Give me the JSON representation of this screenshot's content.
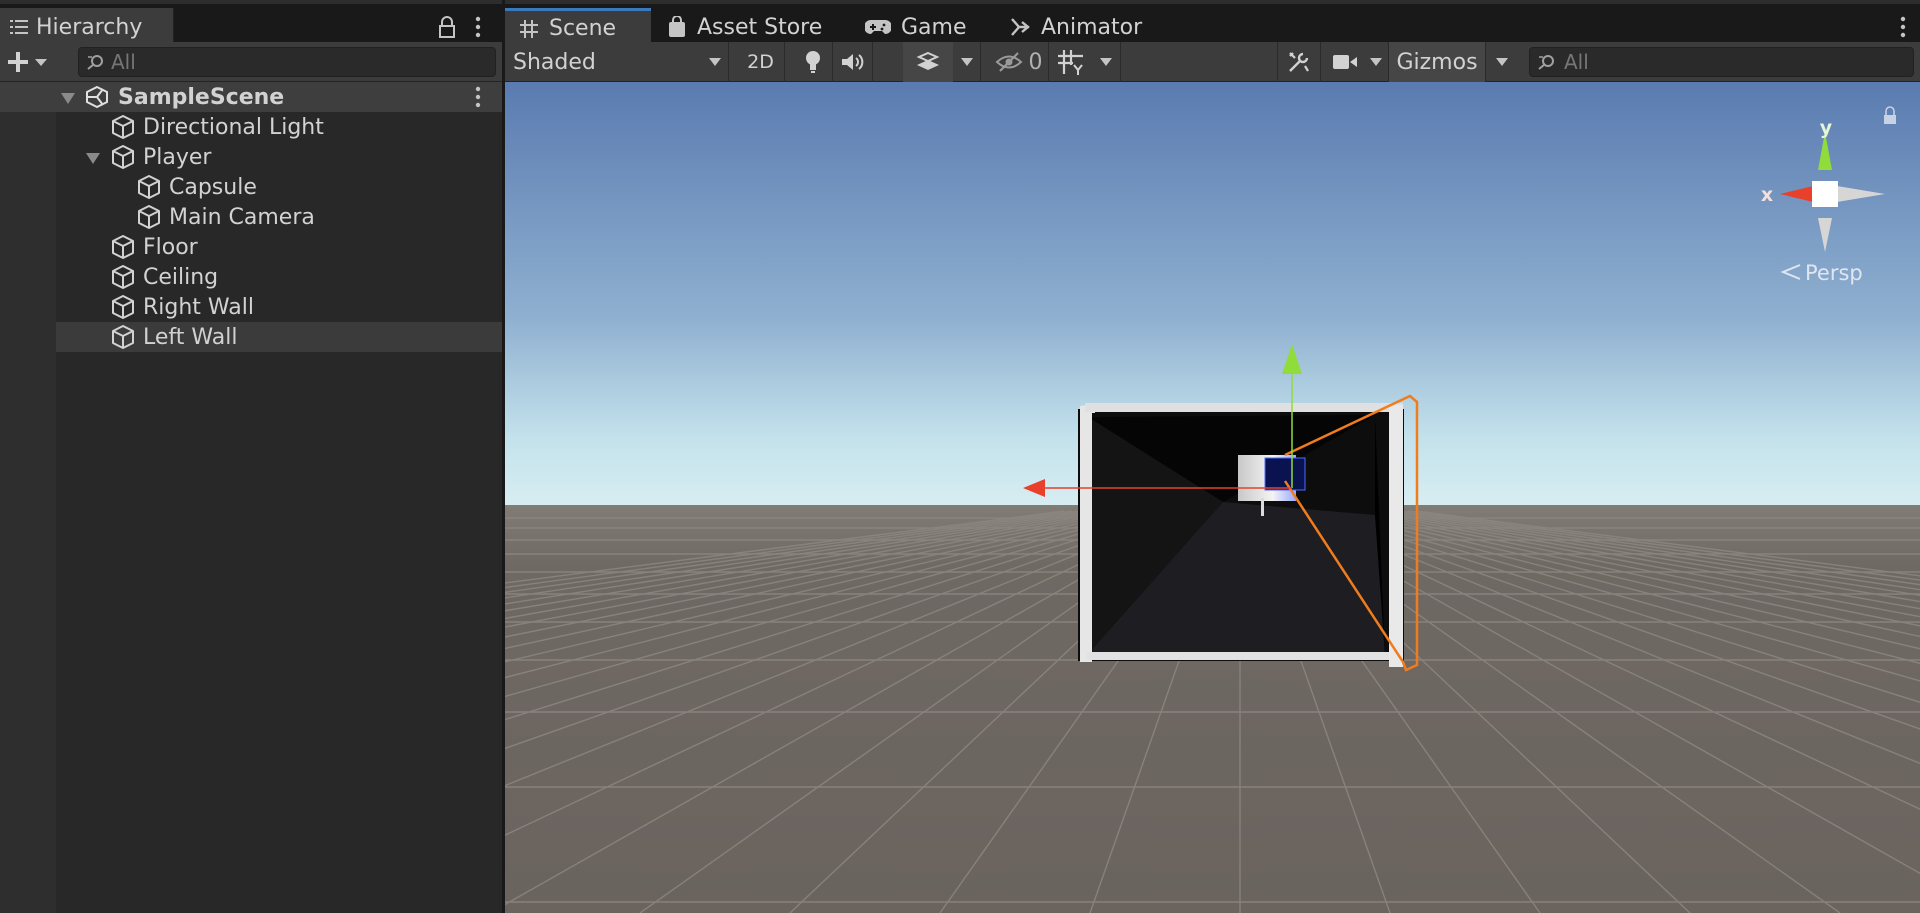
{
  "hierarchy": {
    "tab_label": "Hierarchy",
    "search_placeholder": "All",
    "scene": {
      "name": "SampleScene"
    },
    "items": [
      {
        "name": "Directional Light",
        "depth": 1,
        "expandable": false,
        "selected": false
      },
      {
        "name": "Player",
        "depth": 1,
        "expandable": true,
        "selected": false
      },
      {
        "name": "Capsule",
        "depth": 2,
        "expandable": false,
        "selected": false
      },
      {
        "name": "Main Camera",
        "depth": 2,
        "expandable": false,
        "selected": false
      },
      {
        "name": "Floor",
        "depth": 1,
        "expandable": false,
        "selected": false
      },
      {
        "name": "Ceiling",
        "depth": 1,
        "expandable": false,
        "selected": false
      },
      {
        "name": "Right Wall",
        "depth": 1,
        "expandable": false,
        "selected": false
      },
      {
        "name": "Left Wall",
        "depth": 1,
        "expandable": false,
        "selected": true
      }
    ]
  },
  "tabs": [
    {
      "label": "Scene",
      "icon": "grid-icon",
      "active": true
    },
    {
      "label": "Asset Store",
      "icon": "shopping-bag-icon",
      "active": false
    },
    {
      "label": "Game",
      "icon": "gamepad-icon",
      "active": false
    },
    {
      "label": "Animator",
      "icon": "animator-icon",
      "active": false
    }
  ],
  "toolbar": {
    "draw_mode": "Shaded",
    "mode_2d": "2D",
    "hidden_count": "0",
    "gizmos": "Gizmos",
    "search_placeholder": "All"
  },
  "viewport": {
    "gizmo_axis_x": "x",
    "gizmo_axis_y": "y",
    "projection": "Persp",
    "colors": {
      "sky_top": "#5a7bb0",
      "horizon": "#d9eef2",
      "ground": "#6b6560",
      "selection": "#f07c1e",
      "axis_x": "#e8402a",
      "axis_y": "#8fdc3a"
    }
  }
}
